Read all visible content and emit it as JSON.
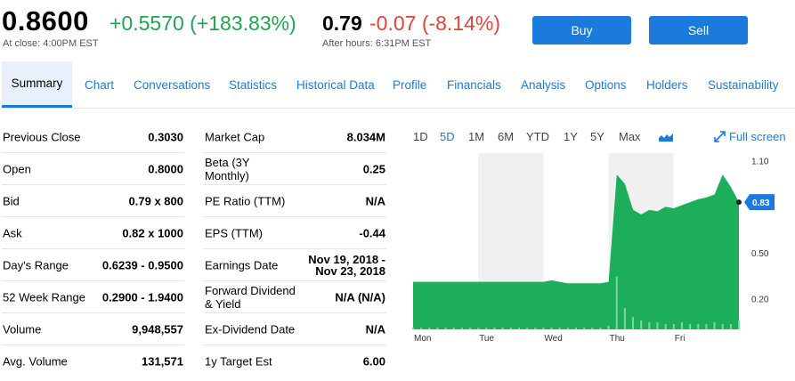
{
  "quote": {
    "price": "0.8600",
    "change": "+0.5570 (+183.83%)",
    "close_label": "At close: 4:00PM EST",
    "ah_price": "0.79",
    "ah_change": "-0.07 (-8.14%)",
    "ah_label": "After hours: 6:31PM EST"
  },
  "actions": {
    "buy": "Buy",
    "sell": "Sell"
  },
  "tabs": [
    {
      "label": "Summary",
      "active": true
    },
    {
      "label": "Chart"
    },
    {
      "label": "Conversations"
    },
    {
      "label": "Statistics"
    },
    {
      "label": "Historical Data"
    },
    {
      "label": "Profile"
    },
    {
      "label": "Financials"
    },
    {
      "label": "Analysis"
    },
    {
      "label": "Options"
    },
    {
      "label": "Holders"
    },
    {
      "label": "Sustainability"
    }
  ],
  "stats_left": [
    {
      "label": "Previous Close",
      "value": "0.3030"
    },
    {
      "label": "Open",
      "value": "0.8000"
    },
    {
      "label": "Bid",
      "value": "0.79 x 800"
    },
    {
      "label": "Ask",
      "value": "0.82 x 1000"
    },
    {
      "label": "Day's Range",
      "value": "0.6239 - 0.9500"
    },
    {
      "label": "52 Week Range",
      "value": "0.2900 - 1.9400"
    },
    {
      "label": "Volume",
      "value": "9,948,557"
    },
    {
      "label": "Avg. Volume",
      "value": "131,571"
    }
  ],
  "stats_right": [
    {
      "label": "Market Cap",
      "value": "8.034M"
    },
    {
      "label": "Beta (3Y Monthly)",
      "value": "0.25"
    },
    {
      "label": "PE Ratio (TTM)",
      "value": "N/A"
    },
    {
      "label": "EPS (TTM)",
      "value": "-0.44"
    },
    {
      "label": "Earnings Date",
      "value": "Nov 19, 2018 - Nov 23, 2018"
    },
    {
      "label": "Forward Dividend & Yield",
      "value": "N/A (N/A)"
    },
    {
      "label": "Ex-Dividend Date",
      "value": "N/A"
    },
    {
      "label": "1y Target Est",
      "value": "6.00"
    }
  ],
  "chart_controls": {
    "ranges": [
      "1D",
      "5D",
      "1M",
      "6M",
      "YTD",
      "1Y",
      "5Y",
      "Max"
    ],
    "active_range": "5D",
    "chart_type_icon": "mountain-chart-icon",
    "fullscreen": "Full screen",
    "fullscreen_icon": "expand-arrows-icon"
  },
  "colors": {
    "accent": "#1a7bdc",
    "positive": "#21a453",
    "negative": "#e0443a",
    "area_fill": "#1dae5c",
    "shade": "#f0f0f0"
  },
  "chart_data": {
    "type": "area",
    "x_labels": [
      "Mon",
      "Tue",
      "Wed",
      "Thu",
      "Fri"
    ],
    "y_ticks": [
      "1.10",
      "0.50",
      "0.20"
    ],
    "current_value_label": "0.83",
    "ylim": [
      0,
      1.15
    ],
    "grid": "vertical day bands",
    "series": [
      {
        "values": [
          0.31,
          0.31,
          0.31,
          0.31,
          0.31,
          0.31,
          0.31,
          0.31,
          0.31,
          0.31,
          0.31,
          0.31,
          0.31,
          0.31,
          0.31,
          0.31,
          0.31,
          0.32,
          0.31,
          0.3,
          0.3,
          0.3,
          0.3,
          0.3,
          0.31,
          1.01,
          0.95,
          0.78,
          0.75,
          0.78,
          0.77,
          0.8,
          0.79,
          0.81,
          0.83,
          0.85,
          0.86,
          0.88,
          1.01,
          0.93,
          0.83
        ]
      }
    ],
    "volume_bars": [
      0.01,
      0.01,
      0.01,
      0.01,
      0.01,
      0.01,
      0.01,
      0.01,
      0.01,
      0.01,
      0.01,
      0.01,
      0.01,
      0.01,
      0.01,
      0.01,
      0.01,
      0.01,
      0.01,
      0.01,
      0.01,
      0.01,
      0.01,
      0.01,
      0.02,
      0.3,
      0.12,
      0.07,
      0.05,
      0.04,
      0.04,
      0.03,
      0.03,
      0.04,
      0.03,
      0.03,
      0.03,
      0.04,
      0.03,
      0.03,
      0.05
    ]
  }
}
